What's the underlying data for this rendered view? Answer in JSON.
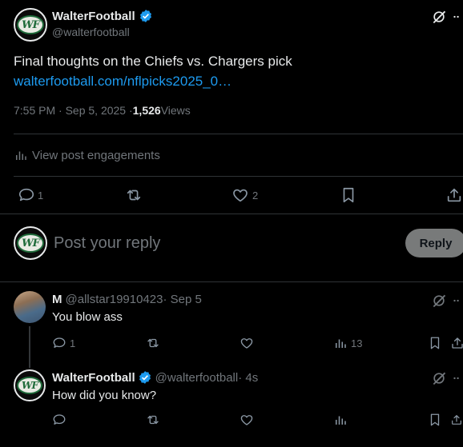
{
  "main_post": {
    "display_name": "WalterFootball",
    "handle": "@walterfootball",
    "avatar_text": "WF",
    "text": "Final thoughts on the Chiefs vs. Chargers pick",
    "link": "walterfootball.com/nflpicks2025_0…",
    "time": "7:55 PM · Sep 5, 2025 · ",
    "views_count": "1,526",
    "views_label": " Views",
    "engagements_label": "View post engagements",
    "replies": "1",
    "likes": "2"
  },
  "reply_box": {
    "placeholder": "Post your reply",
    "button_label": "Reply"
  },
  "replies": [
    {
      "display_name": "M",
      "handle": "@allstar19910423",
      "time": " · Sep 5",
      "text": "You blow ass",
      "replies": "1",
      "views": "13"
    },
    {
      "display_name": "WalterFootball",
      "handle": "@walterfootball",
      "time": " · 4s",
      "text": "How did you know?",
      "avatar_text": "WF"
    }
  ],
  "colors": {
    "background": "#000000",
    "text": "#e7e9ea",
    "muted": "#71767b",
    "link": "#1d9bf0",
    "verified": "#1d9bf0",
    "divider": "#2f3336",
    "reply_button_bg": "#787a7a"
  }
}
